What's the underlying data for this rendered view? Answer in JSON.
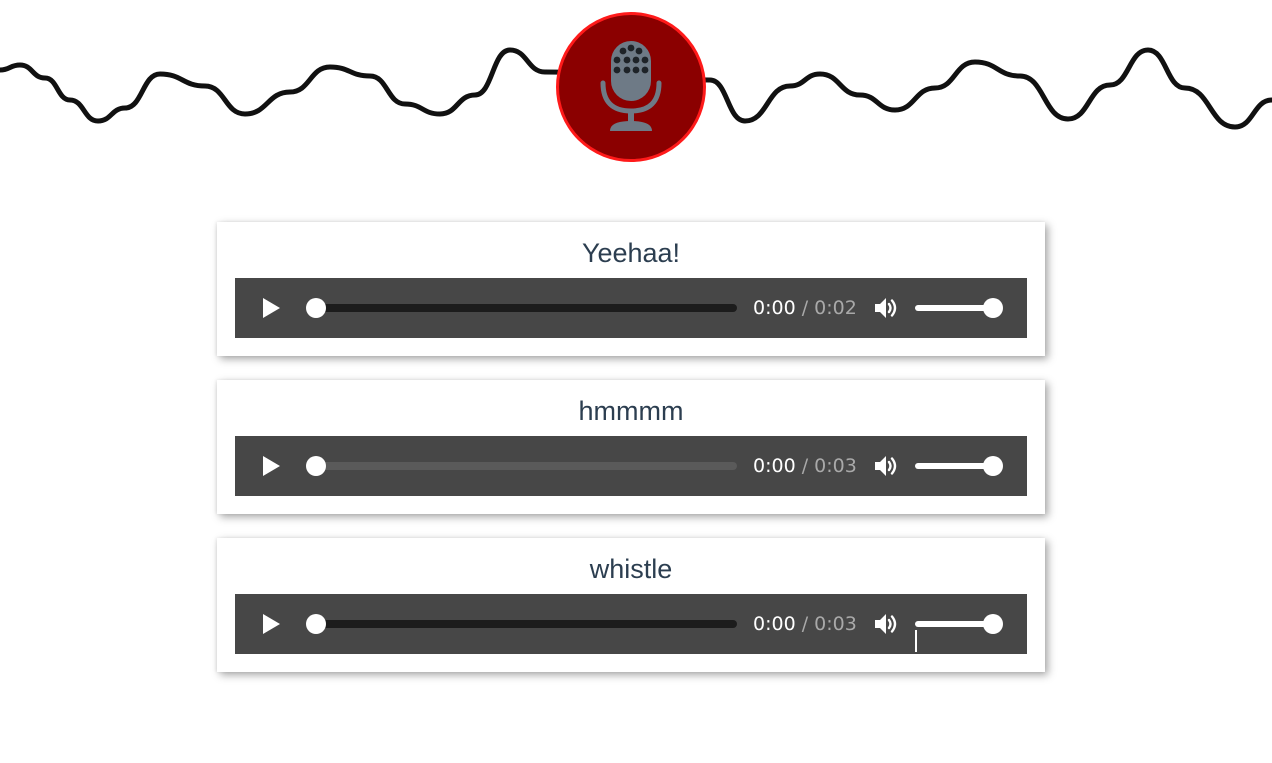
{
  "header": {
    "mic_icon": "microphone-icon",
    "mic_color": "#8b0000",
    "mic_border_color": "#ff1a1a"
  },
  "recordings": [
    {
      "title": "Yeehaa!",
      "current_time": "0:00",
      "separator": "/",
      "duration": "0:02",
      "progress": 0,
      "volume": 1
    },
    {
      "title": "hmmmm",
      "current_time": "0:00",
      "separator": "/",
      "duration": "0:03",
      "progress": 0,
      "volume": 1
    },
    {
      "title": "whistle",
      "current_time": "0:00",
      "separator": "/",
      "duration": "0:03",
      "progress": 0,
      "volume": 1
    }
  ],
  "player": {
    "background": "#474747",
    "play_icon": "play-icon",
    "volume_icon": "volume-icon"
  }
}
